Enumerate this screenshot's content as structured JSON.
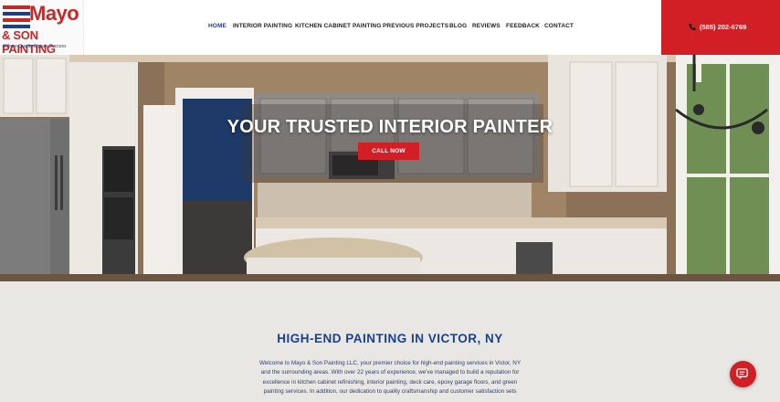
{
  "logo": {
    "brand_top": "Mayo",
    "brand_bottom": "& SON PAINTING",
    "tagline": "Where Quality Equals Success"
  },
  "nav": {
    "items": [
      {
        "label": "HOME",
        "active": true
      },
      {
        "label": "INTERIOR PAINTING",
        "active": false
      },
      {
        "label": "KITCHEN CABINET PAINTING",
        "active": false
      },
      {
        "label": "PREVIOUS PROJECTS",
        "active": false
      },
      {
        "label": "BLOG",
        "active": false
      },
      {
        "label": "REVIEWS",
        "active": false
      },
      {
        "label": "FEEDBACK",
        "active": false
      },
      {
        "label": "CONTACT",
        "active": false
      }
    ]
  },
  "phone": {
    "number": "(585) 202-6769",
    "icon": "phone-icon"
  },
  "hero": {
    "title": "YOUR TRUSTED INTERIOR PAINTER",
    "cta_label": "CALL NOW"
  },
  "content": {
    "title": "HIGH-END PAINTING IN VICTOR, NY",
    "paragraph_lines": [
      "Welcome to Mayo & Son Painting LLC, your premier choice for high-end painting services in Victor, NY",
      "and the surrounding areas. With over 22 years of experience, we've managed to build a reputation for",
      "excellence in kitchen cabinet refinishing, interior painting, deck care, epoxy garage floors, and green",
      "painting services. In addition, our dedication to quality craftsmanship and customer satisfaction sets"
    ]
  },
  "chat": {
    "icon": "chat-icon"
  },
  "colors": {
    "brand_red": "#d21f26",
    "brand_blue": "#1c3f8c",
    "content_bg": "#e9e7e3"
  }
}
